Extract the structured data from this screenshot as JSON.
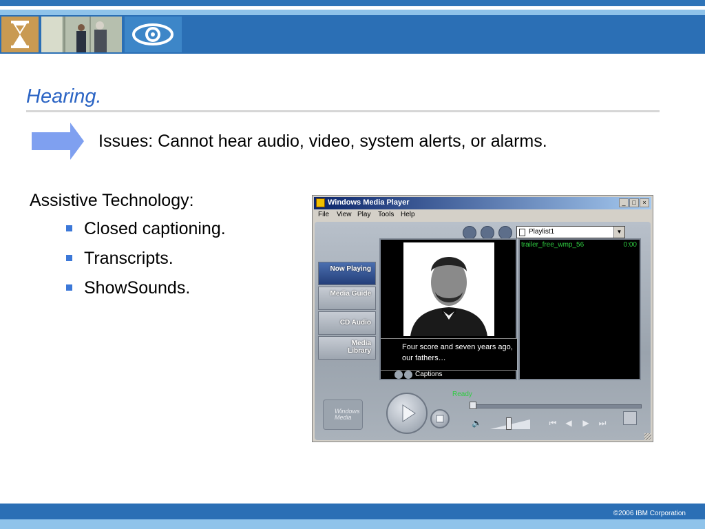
{
  "slide": {
    "title": "Hearing.",
    "issues": "Issues: Cannot hear audio, video, system alerts, or alarms.",
    "assistive_heading": "Assistive Technology:",
    "bullets": [
      "Closed captioning.",
      "Transcripts.",
      "ShowSounds."
    ],
    "footer": "©2006 IBM Corporation"
  },
  "colors": {
    "title": "#2b64c4",
    "header_band": "#2b6fb5",
    "arrow": "#7fa0f0",
    "bullet": "#3c78d8"
  },
  "icons": {
    "header_tiles": [
      "hourglass-icon",
      "business-photo",
      "eye-icon"
    ],
    "arrow": "right-arrow-icon"
  },
  "wmp": {
    "title": "Windows Media Player",
    "window_buttons": [
      "_",
      "□",
      "×"
    ],
    "menu": [
      "File",
      "View",
      "Play",
      "Tools",
      "Help"
    ],
    "playlist_selected": "Playlist1",
    "nav_buttons": [
      "Now Playing",
      "Media Guide",
      "CD Audio",
      "Media Library"
    ],
    "caption_text": "Four score and seven years ago, our fathers…",
    "caption_bar_label": "Captions",
    "track": {
      "name": "trailer_free_wmp_56",
      "time": "0:00"
    },
    "status": "Ready",
    "logo_text": "Windows Media"
  }
}
